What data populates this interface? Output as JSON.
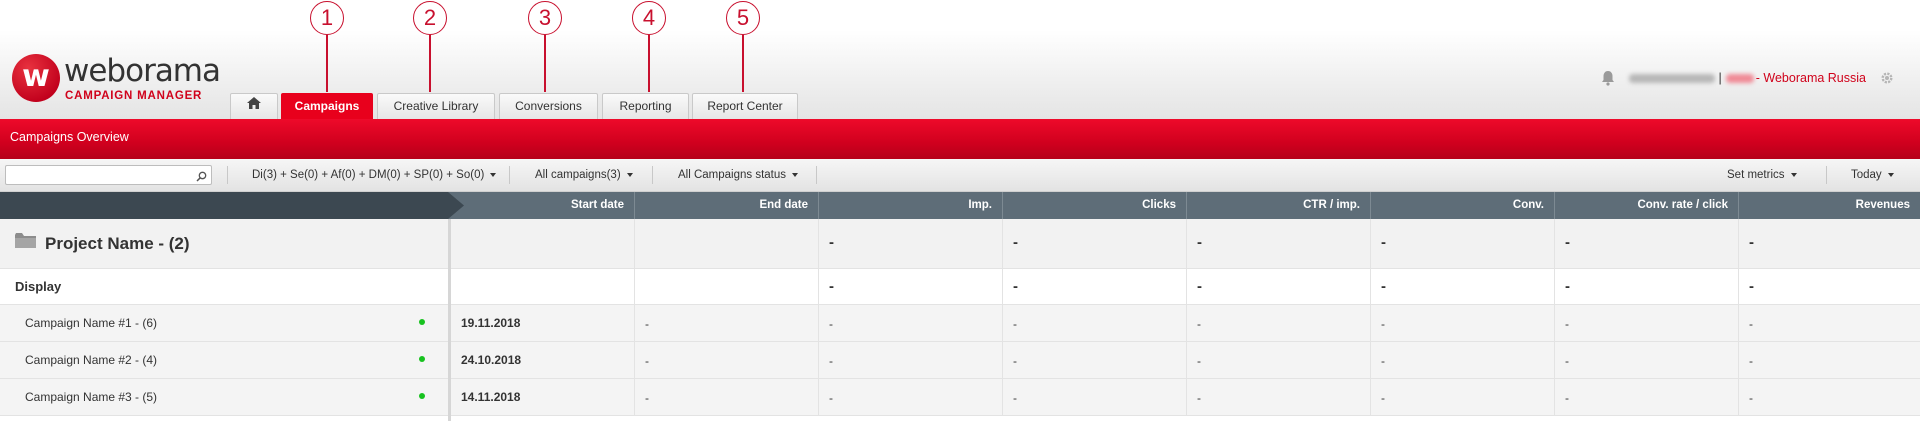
{
  "brand": {
    "logo_letter": "w",
    "name": "weborama",
    "product": "CAMPAIGN MANAGER"
  },
  "markers": [
    "1",
    "2",
    "3",
    "4",
    "5"
  ],
  "tabs": [
    {
      "label": "",
      "icon": "home-icon"
    },
    {
      "label": "Campaigns",
      "active": true
    },
    {
      "label": "Creative Library"
    },
    {
      "label": "Conversions"
    },
    {
      "label": "Reporting"
    },
    {
      "label": "Report Center"
    }
  ],
  "user": {
    "separator": "|",
    "org": "- Weborama Russia",
    "icons": [
      "bell-icon",
      "gear-icon"
    ]
  },
  "banner": {
    "title": "Campaigns Overview"
  },
  "toolbar": {
    "search_value": "",
    "filter_label": "Di(3) + Se(0) + Af(0) + DM(0) + SP(0) + So(0)",
    "campaigns_label": "All campaigns(3)",
    "status_label": "All Campaigns status",
    "metrics_label": "Set metrics",
    "period_label": "Today"
  },
  "columns": [
    "Start date",
    "End date",
    "Imp.",
    "Clicks",
    "CTR / imp.",
    "Conv.",
    "Conv. rate / click",
    "Revenues"
  ],
  "project": {
    "name": "Project Name - (2)",
    "metrics": [
      "-",
      "-",
      "-",
      "-",
      "-",
      "-"
    ]
  },
  "group": {
    "name": "Display",
    "metrics": [
      "-",
      "-",
      "-",
      "-",
      "-",
      "-"
    ]
  },
  "campaigns": [
    {
      "name": "Campaign Name #1 - (6)",
      "start": "19.11.2018",
      "end": "-",
      "metrics": [
        "-",
        "-",
        "-",
        "-",
        "-",
        "-"
      ]
    },
    {
      "name": "Campaign Name #2 - (4)",
      "start": "24.10.2018",
      "end": "-",
      "metrics": [
        "-",
        "-",
        "-",
        "-",
        "-",
        "-"
      ]
    },
    {
      "name": "Campaign Name #3 - (5)",
      "start": "14.11.2018",
      "end": "-",
      "metrics": [
        "-",
        "-",
        "-",
        "-",
        "-",
        "-"
      ]
    }
  ],
  "colors": {
    "brand_red": "#e8001c",
    "header_dark": "#3c4851",
    "header_mid": "#5e6d78",
    "status_active": "#17c21f"
  }
}
